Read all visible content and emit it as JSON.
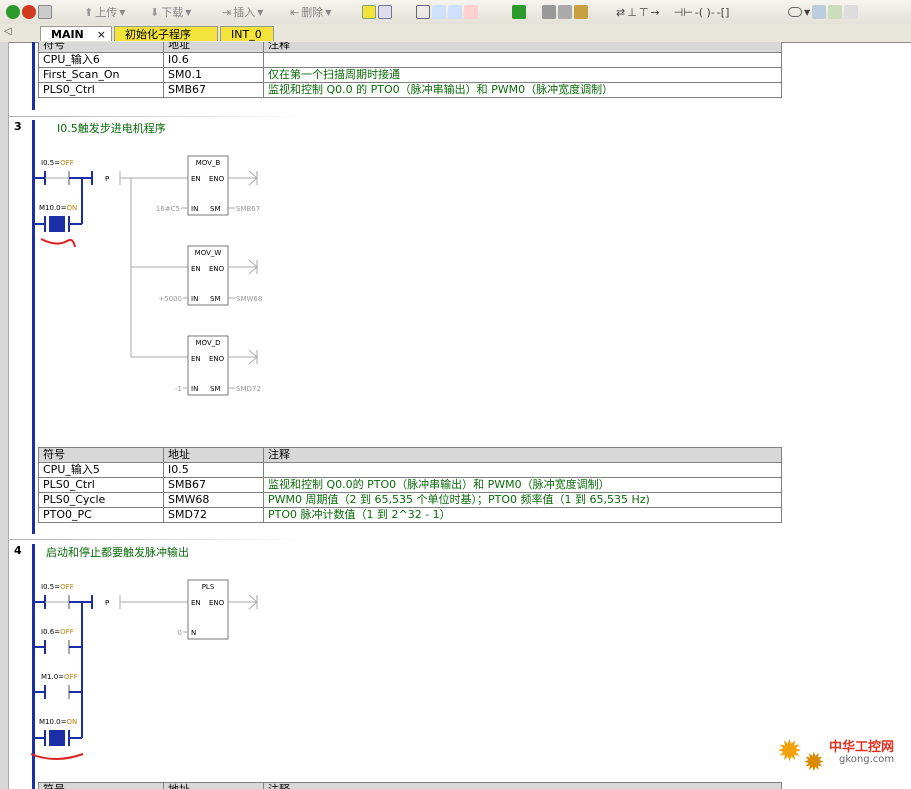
{
  "toolbar": {
    "upload_label": "上传",
    "download_label": "下载",
    "insert_label": "插入",
    "delete_label": "删除"
  },
  "tabs": [
    {
      "label": "MAIN"
    },
    {
      "label": "初始化子程序"
    },
    {
      "label": "INT_0"
    }
  ],
  "colors": {
    "accent": "#1a2ea8",
    "title_green": "#0a6a0a",
    "tab_yellow": "#f3e33a"
  },
  "table_top": {
    "headers": [
      "符号",
      "地址",
      "注释"
    ],
    "rows": [
      [
        "CPU_输入6",
        "I0.6",
        ""
      ],
      [
        "First_Scan_On",
        "SM0.1",
        "仅在第一个扫描周期时接通"
      ],
      [
        "PLS0_Ctrl",
        "SMB67",
        "监视和控制 Q0.0 的 PTO0（脉冲串输出）和 PWM0（脉冲宽度调制）"
      ]
    ]
  },
  "rung3": {
    "number": "3",
    "title": "I0.5触发步进电机程序",
    "contact1": {
      "label": "I0.5=",
      "state": "OFF"
    },
    "contact2": {
      "label": "M10.0=",
      "state": "ON"
    },
    "p_label": "P",
    "boxes": [
      {
        "name": "MOV_B",
        "en": "EN",
        "eno": "ENO",
        "in_pin": "IN",
        "out_pin": "SM",
        "in_value": "16#C5",
        "out_value": "SMB67"
      },
      {
        "name": "MOV_W",
        "en": "EN",
        "eno": "ENO",
        "in_pin": "IN",
        "out_pin": "SM",
        "in_value": "+5000",
        "out_value": "SMW68"
      },
      {
        "name": "MOV_D",
        "en": "EN",
        "eno": "ENO",
        "in_pin": "IN",
        "out_pin": "SM",
        "in_value": "-1",
        "out_value": "SMD72"
      }
    ],
    "table": {
      "headers": [
        "符号",
        "地址",
        "注释"
      ],
      "rows": [
        [
          "CPU_输入5",
          "I0.5",
          ""
        ],
        [
          "PLS0_Ctrl",
          "SMB67",
          "监视和控制 Q0.0的 PTO0（脉冲串输出）和 PWM0（脉冲宽度调制）"
        ],
        [
          "PLS0_Cycle",
          "SMW68",
          "PWM0 周期值（2 到 65,535 个单位时基）；PTO0 频率值（1 到 65,535 Hz)"
        ],
        [
          "PTO0_PC",
          "SMD72",
          "PTO0 脉冲计数值（1 到 2^32 - 1）"
        ]
      ]
    }
  },
  "rung4": {
    "number": "4",
    "title": "启动和停止都要触发脉冲输出",
    "contacts": [
      {
        "label": "I0.5=",
        "state": "OFF"
      },
      {
        "label": "I0.6=",
        "state": "OFF"
      },
      {
        "label": "M1.0=",
        "state": "OFF"
      },
      {
        "label": "M10.0=",
        "state": "ON"
      }
    ],
    "p_label": "P",
    "box": {
      "name": "PLS",
      "en": "EN",
      "eno": "ENO",
      "n_pin": "N",
      "n_value": "0"
    },
    "table_headers": [
      "符号",
      "地址",
      "注释"
    ]
  },
  "watermark": {
    "text": "中华工控网",
    "url": "gkong.com"
  }
}
